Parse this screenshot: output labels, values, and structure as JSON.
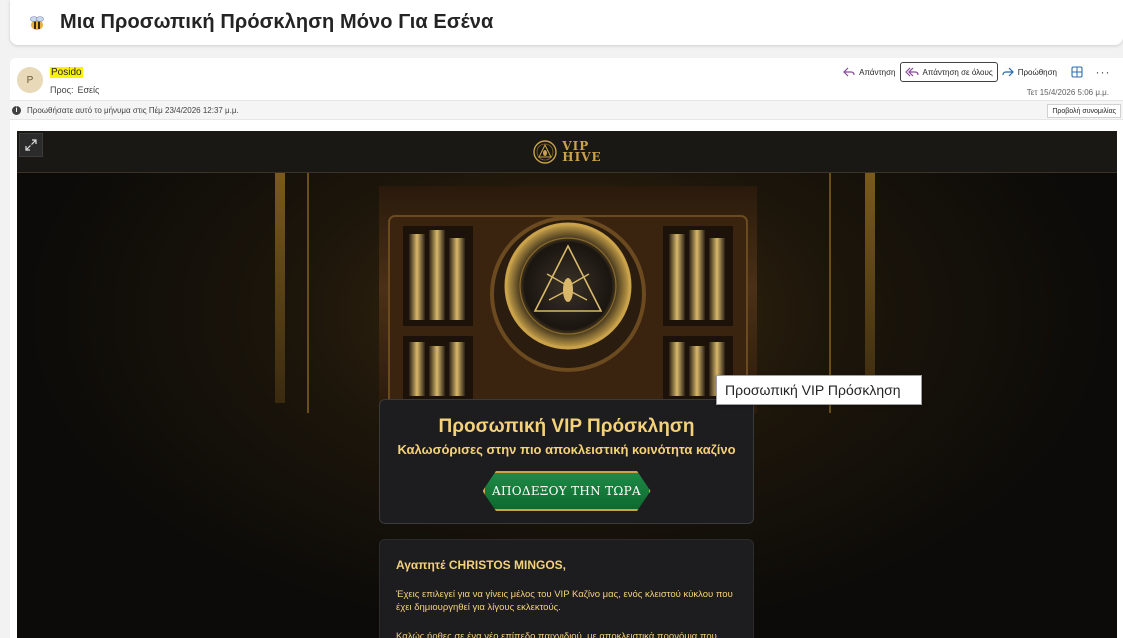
{
  "subject": {
    "title": "Μια Προσωπική Πρόσκληση Μόνο Για Εσένα",
    "icon": "bee-icon"
  },
  "header": {
    "avatar_initial": "P",
    "sender": "Posido",
    "to_label": "Προς:",
    "to_value": "Εσείς",
    "reply_label": "Απάντηση",
    "reply_all_label": "Απάντηση σε όλους",
    "forward_label": "Προώθηση",
    "timestamp": "Τετ 15/4/2026 5:06 μ.μ."
  },
  "info_bar": {
    "text": "Προωθήσατε αυτό το μήνυμα στις Πέμ 23/4/2026 12:37 μ.μ.",
    "conversation_button": "Προβολή συνομιλίας"
  },
  "email": {
    "logo_line1": "VIP",
    "logo_line2": "HIVE",
    "tooltip": "Προσωπική VIP Πρόσκληση",
    "invite_title": "Προσωπική VIP Πρόσκληση",
    "invite_subtitle": "Καλωσόρισες στην πιο αποκλειστική κοινότητα καζίνο",
    "cta_label": "ΑΠΟΔΕΞΟΥ ΤΗΝ ΤΩΡΑ",
    "greeting": "Αγαπητέ CHRISTOS MINGOS,",
    "paragraph1": "Έχεις επιλεγεί για να γίνεις μέλος του VIP Καζίνο μας, ενός κλειστού κύκλου που έχει δημιουργηθεί για λίγους εκλεκτούς.",
    "paragraph2": "Καλώς ήρθες σε ένα νέο επίπεδο παιχνιδιού, με αποκλειστικά προνόμια που"
  },
  "colors": {
    "gold": "#f5d17a",
    "dark": "#0f0f0f",
    "cta_green": "#1f8a46",
    "highlight": "#fff200"
  }
}
